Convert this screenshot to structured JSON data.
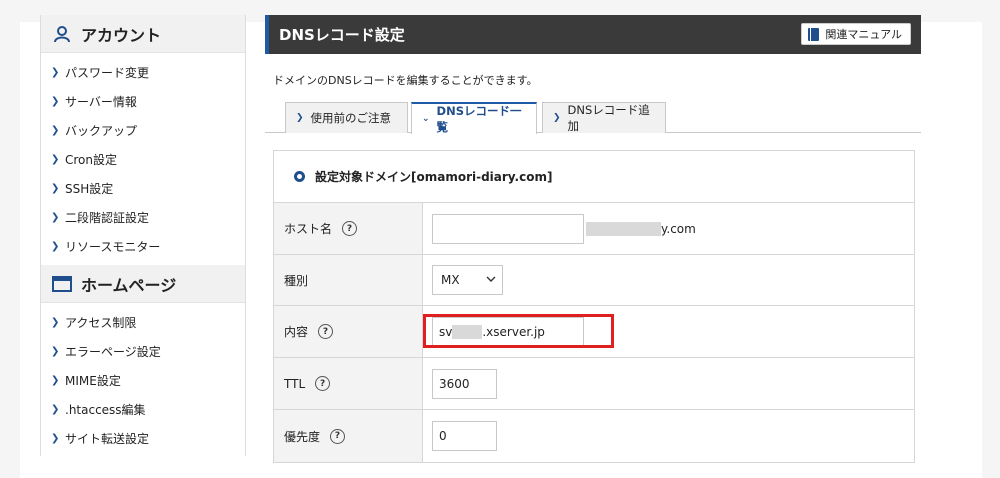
{
  "sidebar": {
    "sections": [
      {
        "title": "アカウント",
        "icon": "user-icon",
        "items": [
          "パスワード変更",
          "サーバー情報",
          "バックアップ",
          "Cron設定",
          "SSH設定",
          "二段階認証設定",
          "リソースモニター"
        ]
      },
      {
        "title": "ホームページ",
        "icon": "window-icon",
        "items": [
          "アクセス制限",
          "エラーページ設定",
          "MIME設定",
          ".htaccess編集",
          "サイト転送設定"
        ]
      }
    ]
  },
  "header": {
    "title": "DNSレコード設定",
    "manual_button": "関連マニュアル"
  },
  "description": "ドメインのDNSレコードを編集することができます。",
  "tabs": [
    {
      "label": "使用前のご注意",
      "active": false
    },
    {
      "label": "DNSレコード一覧",
      "active": true
    },
    {
      "label": "DNSレコード追加",
      "active": false
    }
  ],
  "form": {
    "domain_label": "設定対象ドメイン[omamori-diary.com]",
    "host": {
      "label": "ホスト名",
      "value": "",
      "suffix_tail": "y.com"
    },
    "type": {
      "label": "種別",
      "value": "MX"
    },
    "content": {
      "label": "内容",
      "prefix": "sv",
      "suffix": ".xserver.jp"
    },
    "ttl": {
      "label": "TTL",
      "value": "3600"
    },
    "priority": {
      "label": "優先度",
      "value": "0"
    }
  },
  "help_glyph": "?",
  "colors": {
    "accent": "#1f5aa8",
    "header_bg": "#3a3a3a",
    "highlight": "#e0201e"
  }
}
